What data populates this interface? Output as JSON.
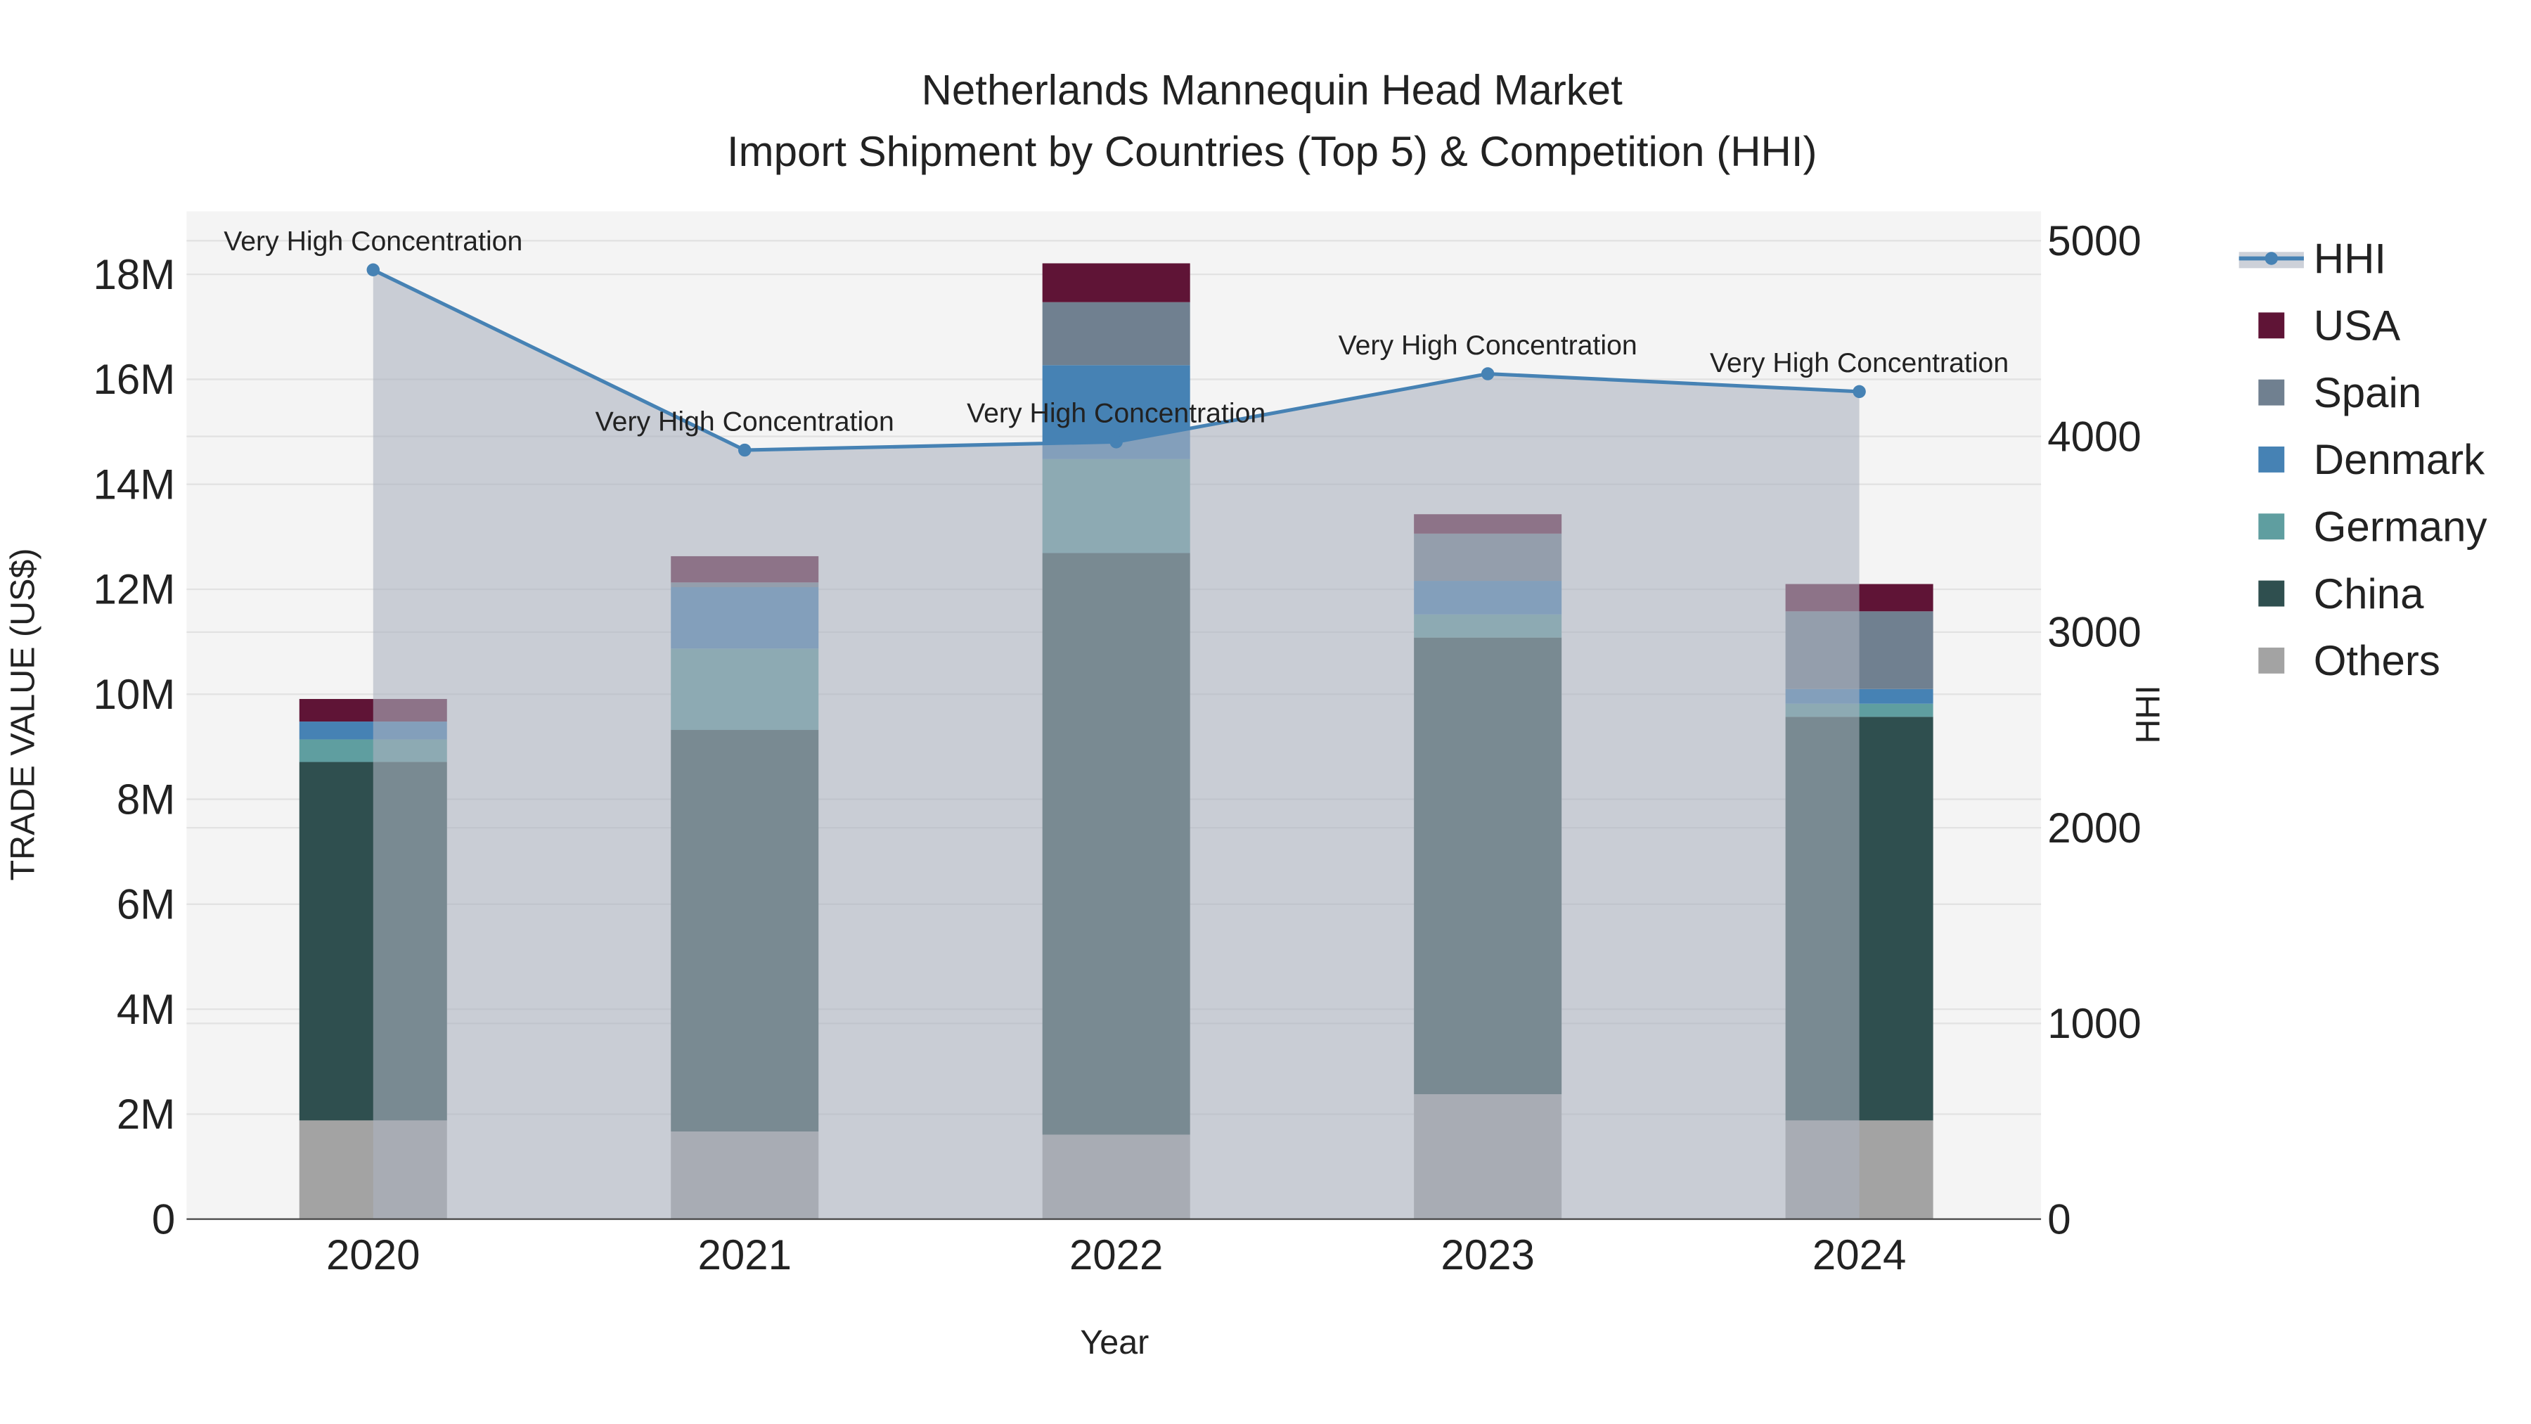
{
  "chart_data": {
    "type": "bar",
    "title_line1": "Netherlands Mannequin Head Market",
    "title_line2": "Import Shipment by Countries (Top 5) & Competition (HHI)",
    "xlabel": "Year",
    "ylabel": "TRADE VALUE (US$)",
    "y2label": "HHI",
    "categories": [
      "2020",
      "2021",
      "2022",
      "2023",
      "2024"
    ],
    "ylim": [
      0,
      19200000
    ],
    "y2lim": [
      0,
      5150
    ],
    "yticks": [
      {
        "v": 0,
        "label": "0"
      },
      {
        "v": 2000000,
        "label": "2M"
      },
      {
        "v": 4000000,
        "label": "4M"
      },
      {
        "v": 6000000,
        "label": "6M"
      },
      {
        "v": 8000000,
        "label": "8M"
      },
      {
        "v": 10000000,
        "label": "10M"
      },
      {
        "v": 12000000,
        "label": "12M"
      },
      {
        "v": 14000000,
        "label": "14M"
      },
      {
        "v": 16000000,
        "label": "16M"
      },
      {
        "v": 18000000,
        "label": "18M"
      }
    ],
    "y2ticks": [
      {
        "v": 0,
        "label": "0"
      },
      {
        "v": 1000,
        "label": "1000"
      },
      {
        "v": 2000,
        "label": "2000"
      },
      {
        "v": 3000,
        "label": "3000"
      },
      {
        "v": 4000,
        "label": "4000"
      },
      {
        "v": 5000,
        "label": "5000"
      }
    ],
    "grid": true,
    "legend_placement": "right",
    "series": [
      {
        "name": "Others",
        "color": "#a3a3a3",
        "values": [
          1880000,
          1670000,
          1610000,
          2380000,
          1880000
        ]
      },
      {
        "name": "China",
        "color": "#2f4f4f",
        "values": [
          6830000,
          7650000,
          11080000,
          8700000,
          7690000
        ]
      },
      {
        "name": "Germany",
        "color": "#5f9ea0",
        "values": [
          430000,
          1550000,
          1790000,
          440000,
          250000
        ]
      },
      {
        "name": "Denmark",
        "color": "#4682b4",
        "values": [
          340000,
          1170000,
          1790000,
          640000,
          280000
        ]
      },
      {
        "name": "Spain",
        "color": "#708090",
        "values": [
          0,
          90000,
          1200000,
          900000,
          1480000
        ]
      },
      {
        "name": "USA",
        "color": "#5f1436",
        "values": [
          430000,
          500000,
          740000,
          370000,
          520000
        ]
      }
    ],
    "hhi": {
      "name": "HHI",
      "color": "#4682b4",
      "values": [
        4851,
        3930,
        3972,
        4320,
        4229
      ],
      "annotations": [
        "Very High Concentration",
        "Very High Concentration",
        "Very High Concentration",
        "Very High Concentration",
        "Very High Concentration"
      ]
    },
    "legend_order": [
      "HHI",
      "USA",
      "Spain",
      "Denmark",
      "Germany",
      "China",
      "Others"
    ]
  }
}
